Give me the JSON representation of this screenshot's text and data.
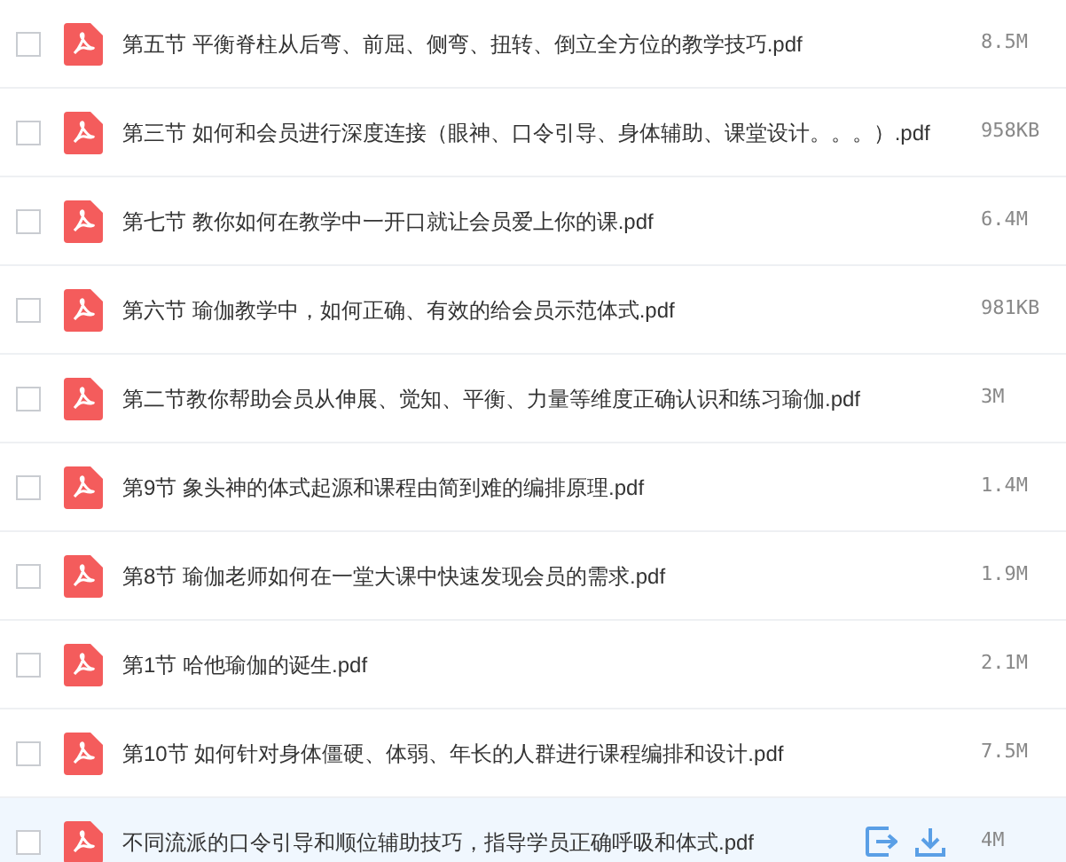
{
  "files": [
    {
      "name": "第五节 平衡脊柱从后弯、前屈、侧弯、扭转、倒立全方位的教学技巧.pdf",
      "size": "8.5M",
      "checked": false,
      "hovered": false
    },
    {
      "name": "第三节 如何和会员进行深度连接（眼神、口令引导、身体辅助、课堂设计。。。）.pdf",
      "size": "958KB",
      "checked": false,
      "hovered": false
    },
    {
      "name": "第七节 教你如何在教学中一开口就让会员爱上你的课.pdf",
      "size": "6.4M",
      "checked": false,
      "hovered": false
    },
    {
      "name": "第六节 瑜伽教学中，如何正确、有效的给会员示范体式.pdf",
      "size": "981KB",
      "checked": false,
      "hovered": false
    },
    {
      "name": "第二节教你帮助会员从伸展、觉知、平衡、力量等维度正确认识和练习瑜伽.pdf",
      "size": "3M",
      "checked": false,
      "hovered": false
    },
    {
      "name": "第9节 象头神的体式起源和课程由简到难的编排原理.pdf",
      "size": "1.4M",
      "checked": false,
      "hovered": false
    },
    {
      "name": "第8节 瑜伽老师如何在一堂大课中快速发现会员的需求.pdf",
      "size": "1.9M",
      "checked": false,
      "hovered": false
    },
    {
      "name": "第1节 哈他瑜伽的诞生.pdf",
      "size": "2.1M",
      "checked": false,
      "hovered": false
    },
    {
      "name": "第10节 如何针对身体僵硬、体弱、年长的人群进行课程编排和设计.pdf",
      "size": "7.5M",
      "checked": false,
      "hovered": false
    },
    {
      "name": "不同流派的口令引导和顺位辅助技巧，指导学员正确呼吸和体式.pdf",
      "size": "4M",
      "checked": false,
      "hovered": true
    }
  ]
}
